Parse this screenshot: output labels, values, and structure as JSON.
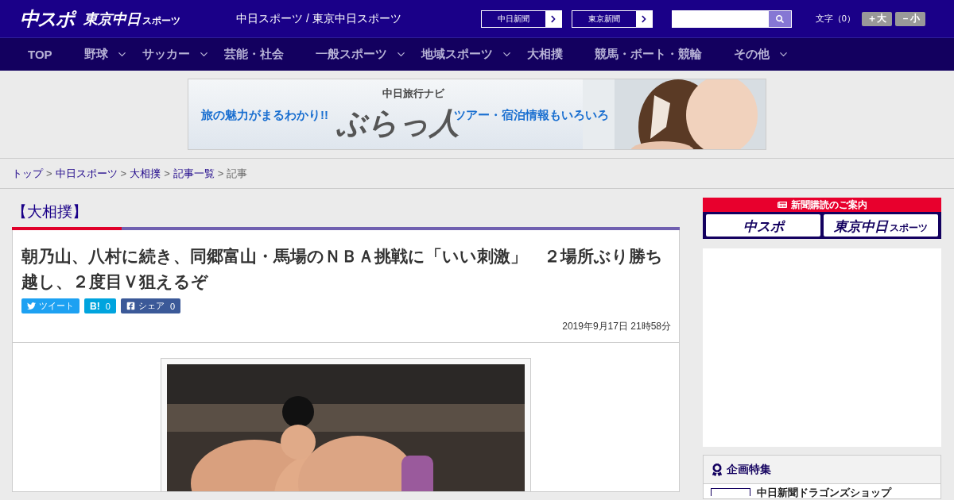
{
  "header": {
    "logo_main": "中スポ",
    "logo_sub": "東京中日",
    "logo_sub_small": "スポーツ",
    "site_names": "中日スポーツ / 東京中日スポーツ",
    "links": [
      "中日新聞",
      "東京新聞"
    ],
    "font_size_label": "文字（0）",
    "font_size_buttons": [
      "＋大",
      "－小"
    ]
  },
  "nav": [
    {
      "label": "TOP",
      "dropdown": false
    },
    {
      "label": "野球",
      "dropdown": true
    },
    {
      "label": "サッカー",
      "dropdown": true
    },
    {
      "label": "芸能・社会",
      "dropdown": false
    },
    {
      "label": "一般スポーツ",
      "dropdown": true
    },
    {
      "label": "地域スポーツ",
      "dropdown": true
    },
    {
      "label": "大相撲",
      "dropdown": false
    },
    {
      "label": "競馬・ボート・競輪",
      "dropdown": false
    },
    {
      "label": "その他",
      "dropdown": true
    }
  ],
  "banner": {
    "brand": "中日旅行ナビ",
    "name": "ぶらっ人",
    "left_copy": "旅の魅力がまるわかり!!",
    "right_copy": "ツアー・宿泊情報もいろいろ"
  },
  "breadcrumb": {
    "separator": ">",
    "links": [
      "トップ",
      "中日スポーツ",
      "大相撲",
      "記事一覧"
    ],
    "current": "記事"
  },
  "article": {
    "category": "【大相撲】",
    "title": "朝乃山、八村に続き、同郷富山・馬場のＮＢＡ挑戦に「いい刺激」　２場所ぶり勝ち越し、２度目Ｖ狙えるぞ",
    "share": [
      {
        "kind": "twitter",
        "label": "ツイート"
      },
      {
        "kind": "hatena",
        "label": "B!",
        "count": "0"
      },
      {
        "kind": "facebook",
        "label": "シェア",
        "count": "0"
      }
    ],
    "date": "2019年9月17日 21時58分"
  },
  "sidebar": {
    "subscribe_title": "新聞購読のご案内",
    "subscribe_logos": [
      {
        "main": "中スポ"
      },
      {
        "main": "東京中日",
        "small": "スポーツ"
      }
    ],
    "feature_title": "企画特集",
    "feature_items": [
      "中日新聞ドラゴンズショップ"
    ]
  }
}
